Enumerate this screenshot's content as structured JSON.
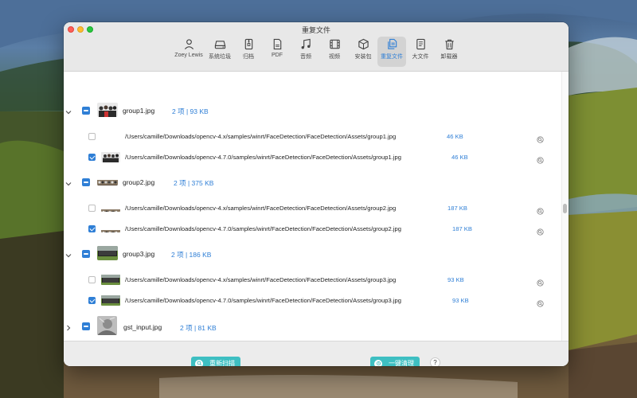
{
  "window": {
    "title": "重复文件"
  },
  "toolbar": {
    "items": [
      {
        "label": "Zoey Lewis",
        "icon": "user-icon",
        "active": false
      },
      {
        "label": "系统垃圾",
        "icon": "disk-icon",
        "active": false
      },
      {
        "label": "归档",
        "icon": "archive-icon",
        "active": false
      },
      {
        "label": "PDF",
        "icon": "pdf-icon",
        "active": false
      },
      {
        "label": "音频",
        "icon": "music-icon",
        "active": false
      },
      {
        "label": "视频",
        "icon": "film-icon",
        "active": false
      },
      {
        "label": "安装包",
        "icon": "package-icon",
        "active": false
      },
      {
        "label": "重复文件",
        "icon": "duplicate-files-icon",
        "active": true
      },
      {
        "label": "大文件",
        "icon": "large-file-icon",
        "active": false
      },
      {
        "label": "卸载器",
        "icon": "trash-icon",
        "active": false
      }
    ]
  },
  "groups": [
    {
      "name": "group1.jpg",
      "summary": "2 项 | 93 KB",
      "expanded": true,
      "files": [
        {
          "path": "/Users/camille/Downloads/opencv-4.x/samples/winrt/FaceDetection/FaceDetection/Assets/group1.jpg",
          "size": "46 KB",
          "checked": false
        },
        {
          "path": "/Users/camille/Downloads/opencv-4.7.0/samples/winrt/FaceDetection/FaceDetection/Assets/group1.jpg",
          "size": "46 KB",
          "checked": true
        }
      ]
    },
    {
      "name": "group2.jpg",
      "summary": "2 项 | 375 KB",
      "expanded": true,
      "files": [
        {
          "path": "/Users/camille/Downloads/opencv-4.x/samples/winrt/FaceDetection/FaceDetection/Assets/group2.jpg",
          "size": "187 KB",
          "checked": false
        },
        {
          "path": "/Users/camille/Downloads/opencv-4.7.0/samples/winrt/FaceDetection/FaceDetection/Assets/group2.jpg",
          "size": "187 KB",
          "checked": true
        }
      ]
    },
    {
      "name": "group3.jpg",
      "summary": "2 项 | 186 KB",
      "expanded": true,
      "files": [
        {
          "path": "/Users/camille/Downloads/opencv-4.x/samples/winrt/FaceDetection/FaceDetection/Assets/group3.jpg",
          "size": "93 KB",
          "checked": false
        },
        {
          "path": "/Users/camille/Downloads/opencv-4.7.0/samples/winrt/FaceDetection/FaceDetection/Assets/group3.jpg",
          "size": "93 KB",
          "checked": true
        }
      ]
    },
    {
      "name": "gst_input.jpg",
      "summary": "2 项 | 81 KB",
      "expanded": false,
      "files": []
    }
  ],
  "footer": {
    "rescan_label": "重新扫描",
    "clean_label": "一键清理",
    "help_label": "?"
  },
  "colors": {
    "accent": "#2f7fd6",
    "button": "#3ebfc2"
  }
}
